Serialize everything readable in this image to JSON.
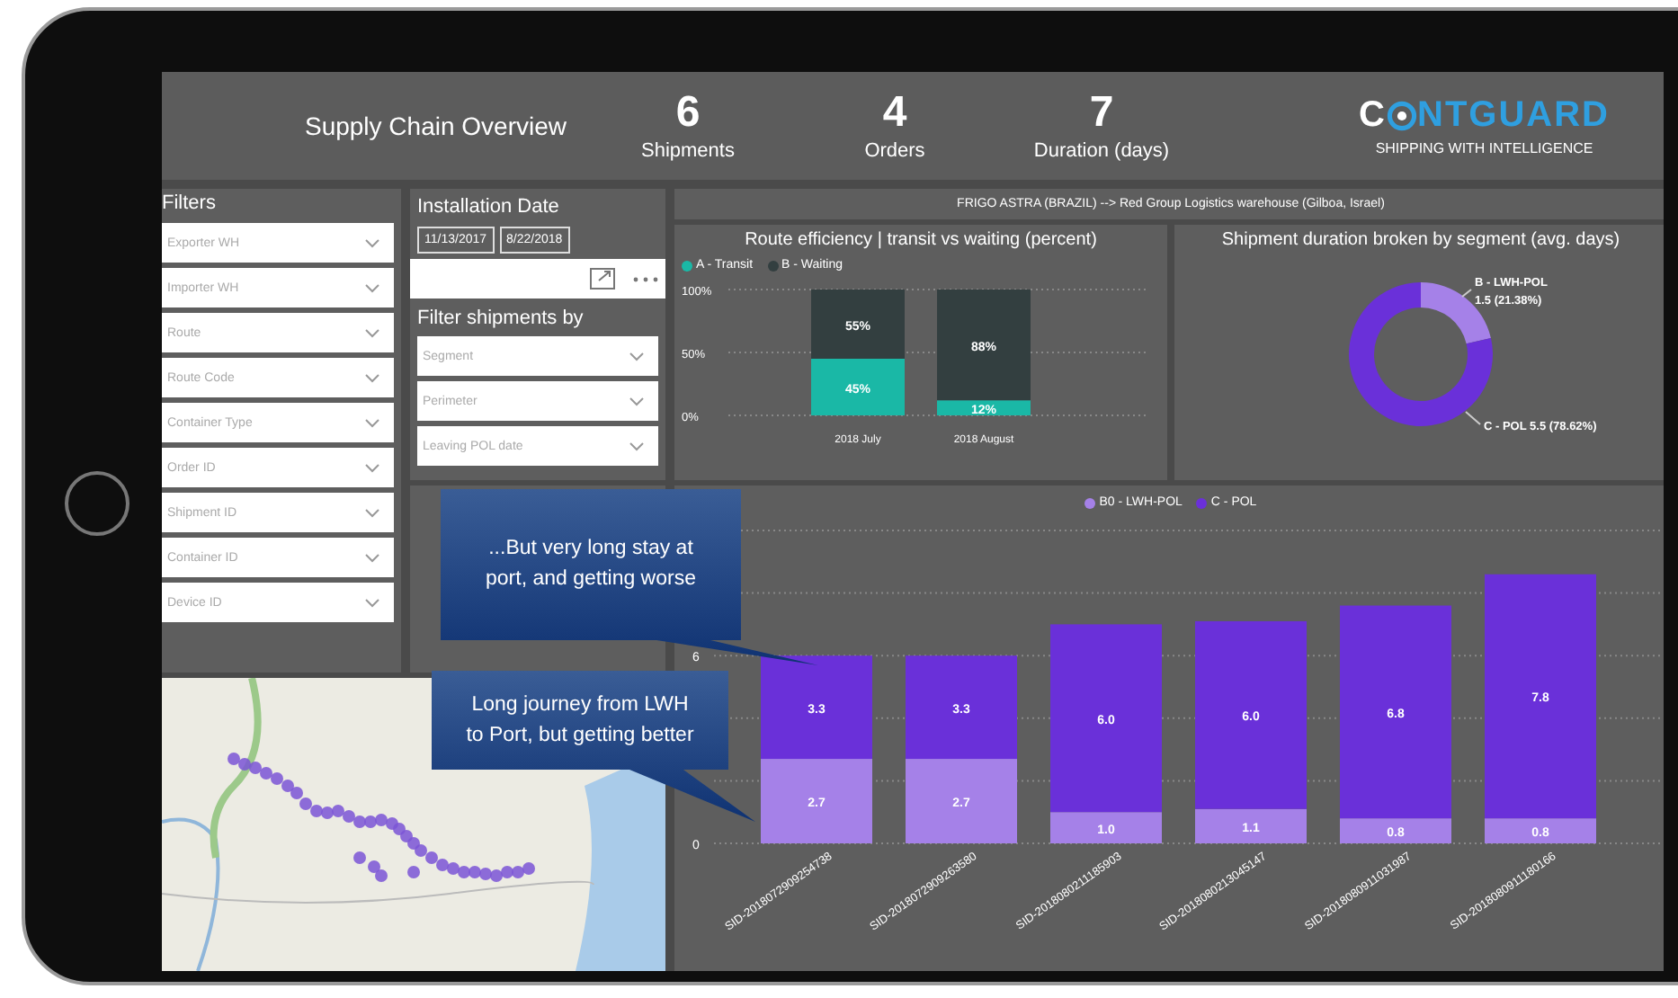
{
  "header": {
    "title": "Supply Chain Overview",
    "kpis": [
      {
        "value": "6",
        "label": "Shipments"
      },
      {
        "value": "4",
        "label": "Orders"
      },
      {
        "value": "7",
        "label": "Duration (days)"
      }
    ],
    "logo": {
      "prefix": "C",
      "suffix": "NTGUARD",
      "tagline": "SHIPPING WITH INTELLIGENCE"
    }
  },
  "filters": {
    "title": "Filters",
    "fields": [
      {
        "placeholder": "Exporter WH"
      },
      {
        "placeholder": "Importer WH"
      },
      {
        "placeholder": "Route"
      },
      {
        "placeholder": "Route Code"
      },
      {
        "placeholder": "Container Type"
      },
      {
        "placeholder": "Order ID"
      },
      {
        "placeholder": "Shipment ID"
      },
      {
        "placeholder": "Container ID"
      },
      {
        "placeholder": "Device ID"
      }
    ]
  },
  "installation": {
    "title": "Installation Date",
    "dates": [
      "11/13/2017",
      "8/22/2018"
    ],
    "filter_title": "Filter shipments by",
    "fields": [
      {
        "placeholder": "Segment"
      },
      {
        "placeholder": "Perimeter"
      },
      {
        "placeholder": "Leaving POL date"
      }
    ]
  },
  "route_banner": "FRIGO ASTRA (BRAZIL) --> Red Group Logistics warehouse (Gilboa, Israel)",
  "efficiency_chart": {
    "chart_data": {
      "type": "bar",
      "title": "Route efficiency | transit vs waiting (percent)",
      "categories": [
        "2018 July",
        "2018 August"
      ],
      "stacked": true,
      "series": [
        {
          "name": "A - Transit",
          "color": "#1ab8a6",
          "values": [
            45,
            12
          ]
        },
        {
          "name": "B - Waiting",
          "color": "#333f40",
          "values": [
            55,
            88
          ]
        }
      ],
      "ylim": [
        0,
        100
      ],
      "yticks": [
        {
          "value": 0,
          "label": "0%"
        },
        {
          "value": 50,
          "label": "50%"
        },
        {
          "value": 100,
          "label": "100%"
        }
      ],
      "value_labels": [
        [
          "45%",
          "12%"
        ],
        [
          "55%",
          "88%"
        ]
      ]
    }
  },
  "duration_chart": {
    "chart_data": {
      "type": "donut",
      "title": "Shipment duration broken by segment (avg. days)",
      "values": [
        21.38,
        78.62
      ],
      "colors": [
        "#a581e8",
        "#6a30d9"
      ],
      "annotations": [
        "B - LWH-POL",
        "1.5 (21.38%)",
        "C - POL 5.5 (78.62%)"
      ]
    }
  },
  "segment_chart": {
    "chart_data": {
      "type": "bar",
      "stacked": true,
      "categories": [
        "SID-2018072909254738",
        "SID-2018072909263580",
        "SID-2018080211185903",
        "SID-2018080213045147",
        "SID-2018080911031987",
        "SID-2018080911180166"
      ],
      "series": [
        {
          "name": "B0 - LWH-POL",
          "color": "#a581e8",
          "values": [
            2.7,
            2.7,
            1.0,
            1.1,
            0.8,
            0.8
          ]
        },
        {
          "name": "C - POL",
          "color": "#6a30d9",
          "values": [
            3.3,
            3.3,
            6.0,
            6.0,
            6.8,
            7.8
          ]
        }
      ],
      "ylim": [
        0,
        10
      ],
      "yticks": [
        0,
        6
      ],
      "value_labels": [
        [
          "2.7",
          "2.7",
          "1.0",
          "1.1",
          "0.8",
          "0.8"
        ],
        [
          "3.3",
          "3.3",
          "6.0",
          "6.0",
          "6.8",
          "7.8"
        ]
      ]
    }
  },
  "callouts": [
    "...But very long stay at port, and getting worse",
    "Long journey from LWH to Port, but getting better"
  ]
}
